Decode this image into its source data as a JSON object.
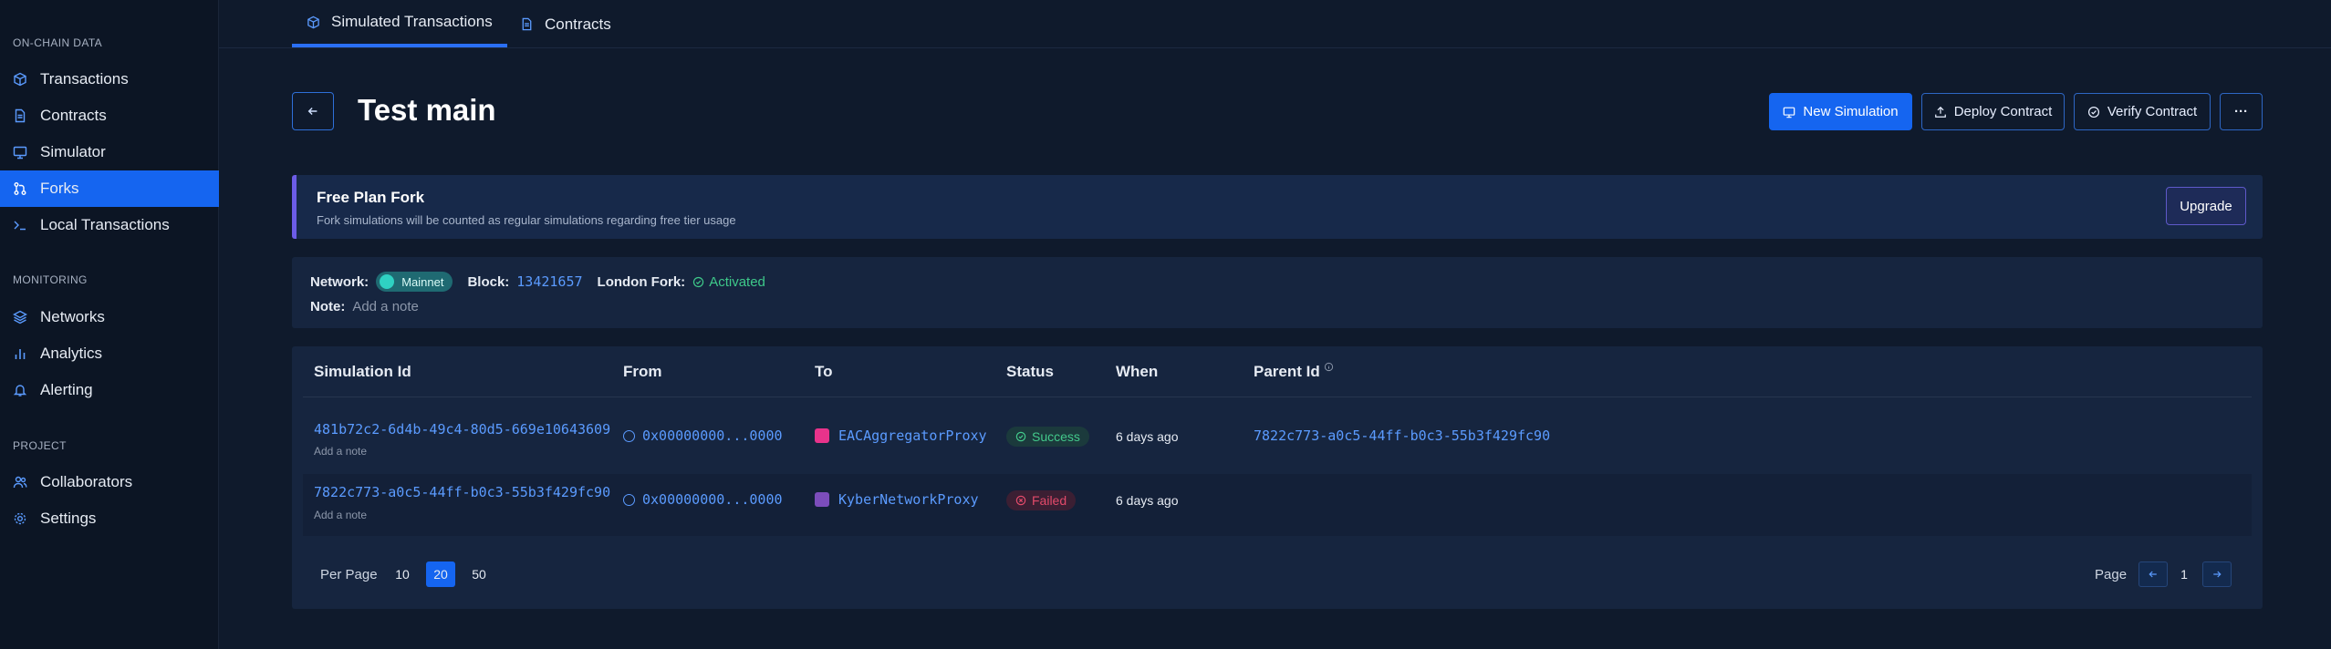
{
  "sidebar": {
    "sections": [
      {
        "title": "ON-CHAIN DATA"
      },
      {
        "title": "MONITORING"
      },
      {
        "title": "PROJECT"
      }
    ],
    "items": [
      {
        "label": "Transactions",
        "icon": "cube-icon"
      },
      {
        "label": "Contracts",
        "icon": "document-icon"
      },
      {
        "label": "Simulator",
        "icon": "monitor-icon"
      },
      {
        "label": "Forks",
        "icon": "fork-icon",
        "active": true
      },
      {
        "label": "Local Transactions",
        "icon": "terminal-icon"
      },
      {
        "label": "Networks",
        "icon": "layers-icon"
      },
      {
        "label": "Analytics",
        "icon": "bar-chart-icon"
      },
      {
        "label": "Alerting",
        "icon": "bell-icon"
      },
      {
        "label": "Collaborators",
        "icon": "users-icon"
      },
      {
        "label": "Settings",
        "icon": "gear-icon"
      }
    ]
  },
  "tabs": [
    {
      "label": "Simulated Transactions",
      "active": true
    },
    {
      "label": "Contracts"
    }
  ],
  "header": {
    "title": "Test main",
    "new_simulation": "New Simulation",
    "deploy_contract": "Deploy Contract",
    "verify_contract": "Verify Contract",
    "more": "···"
  },
  "banner": {
    "title": "Free Plan Fork",
    "subtitle": "Fork simulations will be counted as regular simulations regarding free tier usage",
    "upgrade": "Upgrade"
  },
  "info": {
    "network_label": "Network:",
    "network_value": "Mainnet",
    "block_label": "Block:",
    "block_value": "13421657",
    "london_label": "London Fork:",
    "london_value": "Activated",
    "note_label": "Note:",
    "note_placeholder": "Add a note"
  },
  "table": {
    "columns": [
      "Simulation Id",
      "From",
      "To",
      "Status",
      "When",
      "Parent Id"
    ],
    "rows": [
      {
        "sim_id": "481b72c2-6d4b-49c4-80d5-669e10643609",
        "note": "Add a note",
        "from": "0x00000000...0000",
        "to": "EACAggregatorProxy",
        "status": "Success",
        "when": "6 days ago",
        "parent_id": "7822c773-a0c5-44ff-b0c3-55b3f429fc90"
      },
      {
        "sim_id": "7822c773-a0c5-44ff-b0c3-55b3f429fc90",
        "note": "Add a note",
        "from": "0x00000000...0000",
        "to": "KyberNetworkProxy",
        "status": "Failed",
        "when": "6 days ago",
        "parent_id": ""
      }
    ]
  },
  "pagination": {
    "per_page_label": "Per Page",
    "options": [
      "10",
      "20",
      "50"
    ],
    "selected": "20",
    "page_label": "Page",
    "current_page": "1"
  },
  "colors": {
    "accent": "#1565f0",
    "success": "#43c98b",
    "failed": "#e24a6a",
    "banner_border": "#6c5ce7"
  }
}
